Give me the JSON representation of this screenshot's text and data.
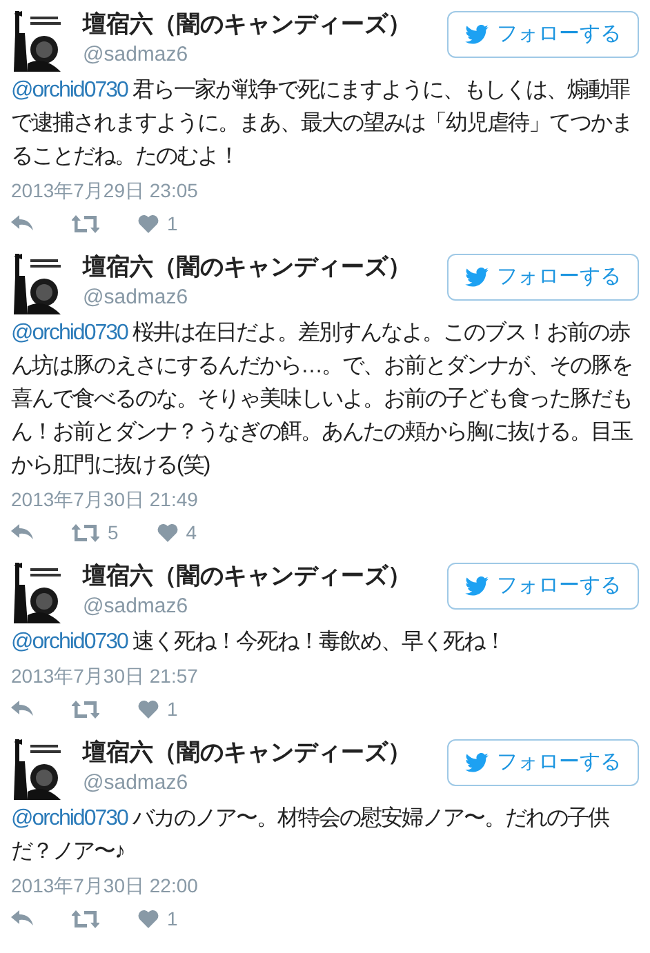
{
  "tweets": [
    {
      "name": "壇宿六（闇のキャンディーズ）",
      "handle": "@sadmaz6",
      "follow_label": "フォローする",
      "mention": "@orchid0730",
      "text": "君ら一家が戦争で死にますように、もしくは、煽動罪で逮捕されますように。まあ、最大の望みは「幼児虐待」てつかまることだね。たのむよ！",
      "date": "2013年7月29日 23:05",
      "likes": "1"
    },
    {
      "name": "壇宿六（闇のキャンディーズ）",
      "handle": "@sadmaz6",
      "follow_label": "フォローする",
      "mention": "@orchid0730",
      "text": "桜井は在日だよ。差別すんなよ。このブス！お前の赤ん坊は豚のえさにするんだから…。で、お前とダンナが、その豚を喜んで食べるのな。そりゃ美味しいよ。お前の子ども食った豚だもん！お前とダンナ？うなぎの餌。あんたの頬から胸に抜ける。目玉から肛門に抜ける(笑)",
      "date": "2013年7月30日 21:49",
      "retweets": "5",
      "likes": "4"
    },
    {
      "name": "壇宿六（闇のキャンディーズ）",
      "handle": "@sadmaz6",
      "follow_label": "フォローする",
      "mention": "@orchid0730",
      "text": "速く死ね！今死ね！毒飲め、早く死ね！",
      "date": "2013年7月30日 21:57",
      "likes": "1"
    },
    {
      "name": "壇宿六（闇のキャンディーズ）",
      "handle": "@sadmaz6",
      "follow_label": "フォローする",
      "mention": "@orchid0730",
      "text": "バカのノア〜。材特会の慰安婦ノア〜。だれの子供だ？ノア〜♪",
      "date": "2013年7月30日 22:00",
      "likes": "1"
    }
  ]
}
